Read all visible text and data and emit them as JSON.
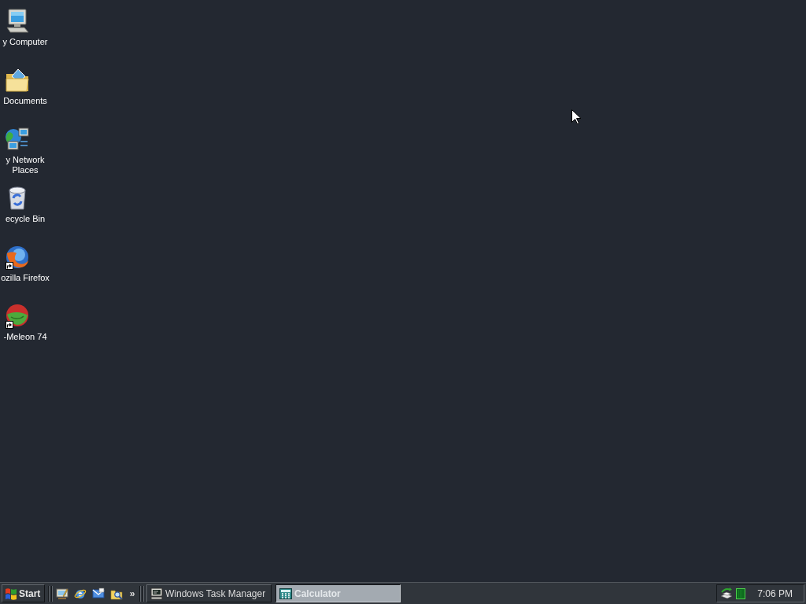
{
  "desktop": {
    "icons": [
      {
        "label": "y Computer",
        "shortcut": false
      },
      {
        "label": "Documents",
        "shortcut": false
      },
      {
        "label": "y Network Places",
        "shortcut": false
      },
      {
        "label": "ecycle Bin",
        "shortcut": false
      },
      {
        "label": "ozilla Firefox",
        "shortcut": true
      },
      {
        "label": "-Meleon 74",
        "shortcut": true
      }
    ]
  },
  "taskbar": {
    "start_button": {
      "label": "Start"
    },
    "quick_launch_more": "»",
    "tasks": [
      {
        "label": "Windows Task Manager",
        "selected": false
      },
      {
        "label": "Calculator",
        "selected": true
      }
    ],
    "tray": {
      "clock": "7:06 PM"
    }
  }
}
